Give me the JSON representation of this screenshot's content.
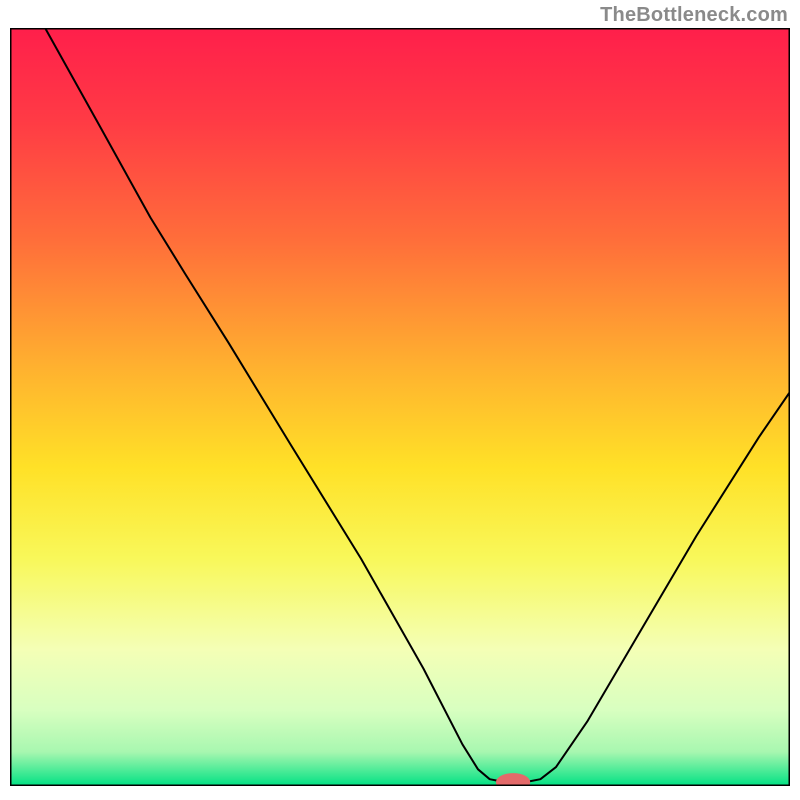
{
  "watermark": "TheBottleneck.com",
  "chart_data": {
    "type": "line",
    "title": "",
    "xlabel": "",
    "ylabel": "",
    "xlim": [
      0,
      100
    ],
    "ylim": [
      0,
      100
    ],
    "grid": false,
    "legend": null,
    "gradient_stops": [
      {
        "offset": 0.0,
        "color": "#ff1f4b"
      },
      {
        "offset": 0.12,
        "color": "#ff3a45"
      },
      {
        "offset": 0.28,
        "color": "#ff6e3a"
      },
      {
        "offset": 0.45,
        "color": "#ffb22f"
      },
      {
        "offset": 0.58,
        "color": "#ffe127"
      },
      {
        "offset": 0.7,
        "color": "#f8f85a"
      },
      {
        "offset": 0.82,
        "color": "#f4ffb6"
      },
      {
        "offset": 0.9,
        "color": "#d8ffc0"
      },
      {
        "offset": 0.955,
        "color": "#a8f7b0"
      },
      {
        "offset": 1.0,
        "color": "#00e183"
      }
    ],
    "series": [
      {
        "name": "curve",
        "color": "#000000",
        "stroke_width": 2,
        "points": [
          {
            "x": 4.5,
            "y": 100.0
          },
          {
            "x": 11.0,
            "y": 88.0
          },
          {
            "x": 18.0,
            "y": 75.0
          },
          {
            "x": 22.5,
            "y": 67.5
          },
          {
            "x": 28.0,
            "y": 58.5
          },
          {
            "x": 36.0,
            "y": 45.0
          },
          {
            "x": 45.0,
            "y": 30.0
          },
          {
            "x": 53.0,
            "y": 15.5
          },
          {
            "x": 58.0,
            "y": 5.5
          },
          {
            "x": 60.0,
            "y": 2.2
          },
          {
            "x": 61.5,
            "y": 0.9
          },
          {
            "x": 63.5,
            "y": 0.5
          },
          {
            "x": 66.0,
            "y": 0.5
          },
          {
            "x": 68.0,
            "y": 0.9
          },
          {
            "x": 70.0,
            "y": 2.5
          },
          {
            "x": 74.0,
            "y": 8.5
          },
          {
            "x": 80.0,
            "y": 19.0
          },
          {
            "x": 88.0,
            "y": 33.0
          },
          {
            "x": 96.0,
            "y": 46.0
          },
          {
            "x": 100.0,
            "y": 52.0
          }
        ]
      }
    ],
    "marker": {
      "x": 64.5,
      "y": 0.5,
      "rx": 2.2,
      "ry": 1.2,
      "color": "#e36a6a"
    },
    "frame": {
      "stroke": "#000000",
      "stroke_width": 3
    }
  }
}
